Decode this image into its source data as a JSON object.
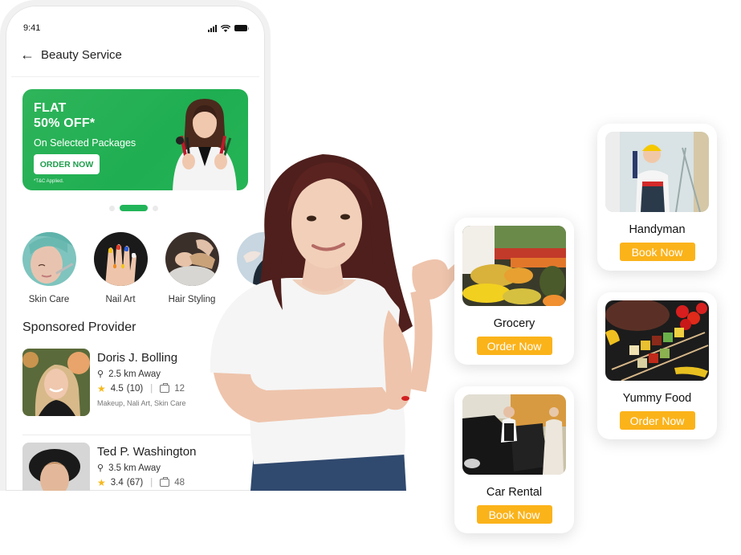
{
  "phone": {
    "status_bar": {
      "time": "9:41",
      "icons": [
        "signal-icon",
        "wifi-icon",
        "battery-icon"
      ]
    },
    "header": {
      "back_icon": "arrow-left-icon",
      "title": "Beauty Service"
    },
    "banner": {
      "line1": "FLAT",
      "line2": "50% OFF*",
      "subtitle": "On Selected Packages",
      "button_label": "ORDER NOW",
      "terms": "*T&C Applied.",
      "color": "#22b459"
    },
    "carousel": {
      "count": 3,
      "active_index": 1
    },
    "categories": [
      {
        "label": "Skin Care"
      },
      {
        "label": "Nail Art"
      },
      {
        "label": "Hair Styling"
      },
      {
        "label": ""
      }
    ],
    "section_title": "Sponsored Provider",
    "providers": [
      {
        "name": "Doris J. Bolling",
        "distance": "2.5 km Away",
        "rating": "4.5",
        "reviews": "(10)",
        "jobs": "12",
        "tags": "Makeup, Nali Art, Skin Care"
      },
      {
        "name": "Ted P. Washington",
        "distance": "3.5 km Away",
        "rating": "3.4",
        "reviews": "(67)",
        "jobs": "48",
        "tags": ""
      }
    ]
  },
  "services": [
    {
      "name": "Grocery",
      "button_label": "Order Now"
    },
    {
      "name": "Handyman",
      "button_label": "Book Now"
    },
    {
      "name": "Yummy Food",
      "button_label": "Order Now"
    },
    {
      "name": "Car Rental",
      "button_label": "Book Now"
    }
  ],
  "colors": {
    "accent_green": "#22b459",
    "cta_yellow": "#fbb31a"
  }
}
